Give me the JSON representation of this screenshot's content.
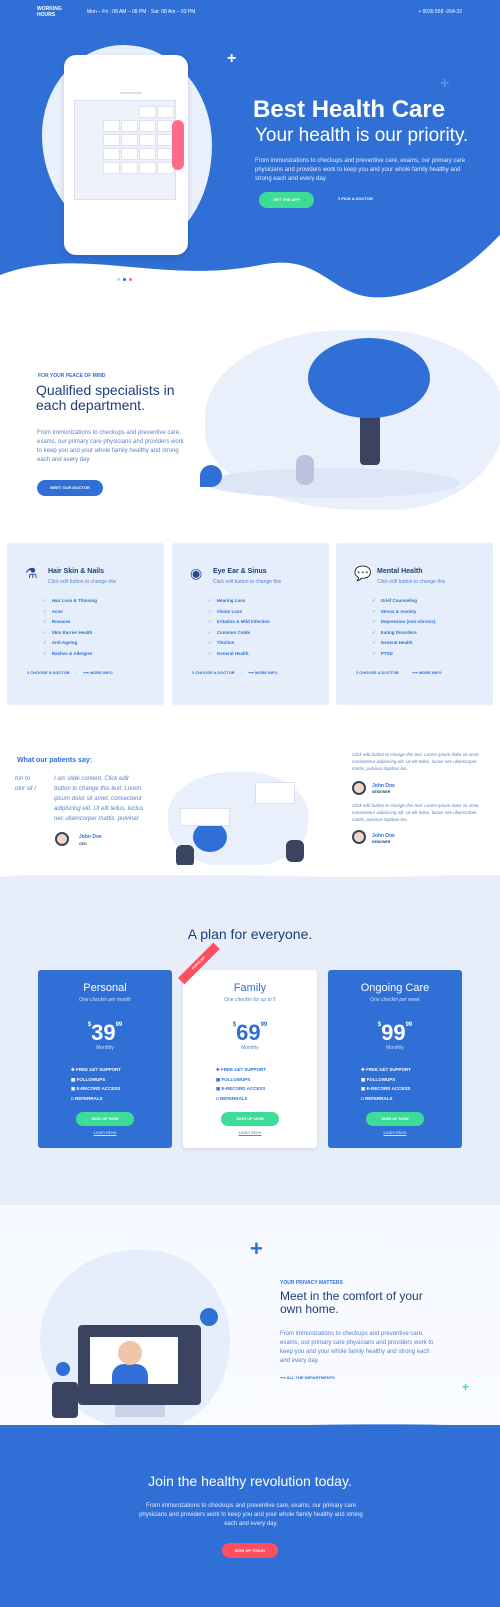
{
  "topbar": {
    "brand_line1": "WORKING",
    "brand_line2": "HOURS",
    "hours": "Mon – Fri : 08 AM – 08 PM · Sat: 08 Am – 03 PM",
    "phone": "+ 0035 558 -264-32"
  },
  "hero": {
    "title": "Best Health Care",
    "subtitle": "Your health is our priority.",
    "description": "From immunizations to checkups and preventive care, exams, our primary care physicians and providers work to keep you and your whole family healthy and strong each and every day.",
    "cta_label": "GET THE APP",
    "doctor_label": "PICK A DOCTOR"
  },
  "qualified": {
    "eyebrow": "FOR YOUR PEACE OF MIND",
    "title": "Qualified specialists in each department.",
    "description": "From immunizations to checkups and preventive care, exams, our primary care physicians and providers work to keep you and your whole family healthy and strong each and every day.",
    "button": "MEET OUR DOCTOR"
  },
  "departments": [
    {
      "icon": "flask-icon",
      "title": "Hair Skin & Nails",
      "subtitle": "Click edit button to change this",
      "items": [
        "Hair Loss & Thinning",
        "Acne",
        "Rosacea",
        "Skin Barrier Health",
        "Anti-Ageing",
        "Rashes & Allergies"
      ],
      "choose": "CHOOSE A DOCTOR",
      "more": "MORE INFO"
    },
    {
      "icon": "eye-icon",
      "title": "Eye Ear & Sinus",
      "subtitle": "Click edit button to change this",
      "items": [
        "Hearing Loss",
        "Vision Loss",
        "Irritation & Mild Infection",
        "Common Colds",
        "Tinnitus",
        "General Health"
      ],
      "choose": "CHOOSE A DOCTOR",
      "more": "MORE INFO"
    },
    {
      "icon": "chat-bubble-icon",
      "title": "Mental Health",
      "subtitle": "Click edit button to change this",
      "items": [
        "Grief Counseling",
        "Stress & Anxiety",
        "Depression (non-chronic)",
        "Eating Disorders",
        "General Health",
        "PTSD"
      ],
      "choose": "CHOOSE A DOCTOR",
      "more": "MORE INFO"
    }
  ],
  "testimonials": {
    "title": "What our patients say:",
    "left_fragment": "ton to olor sit r",
    "quote": "I am slide content. Click edit button to change this text. Lorem ipsum dolor sit amet, consectetur adipiscing elit. Ut elit tellus, luctus nec ullamcorper mattis, pulvinar dapibus leo.",
    "name": "John Doe",
    "role": "CEO",
    "right_quote": "Click edit button to change this text. Lorem ipsum dolor sit amet, consectetur adipiscing elit. Ut elit tellus, luctus nec ullamcorper mattis, pulvinar dapibus leo.",
    "right_name": "John Doe",
    "right_role": "DESIGNER"
  },
  "pricing": {
    "title": "A plan for everyone.",
    "ribbon": "POPULAR",
    "plans": [
      {
        "name": "Personal",
        "note": "One checkin per month",
        "currency": "$",
        "price": "39",
        "cents": "99",
        "period": "Monthly",
        "features": [
          "FREE 24/7 SUPPORT",
          "FOLLOWUPS",
          "E-RECORD ACCESS",
          "REFERRALS"
        ],
        "button": "SIGN UP NOW",
        "learn": "Learn More"
      },
      {
        "name": "Family",
        "note": "One checkin for up to 5",
        "currency": "$",
        "price": "69",
        "cents": "99",
        "period": "Monthly",
        "features": [
          "FREE 24/7 SUPPORT",
          "FOLLOWUPS",
          "E-RECORD ACCESS",
          "REFERRALS"
        ],
        "button": "SIGN UP NOW",
        "learn": "Learn More"
      },
      {
        "name": "Ongoing Care",
        "note": "One checkin per week",
        "currency": "$",
        "price": "99",
        "cents": "99",
        "period": "Monthly",
        "features": [
          "FREE 24/7 SUPPORT",
          "FOLLOWUPS",
          "E-RECORD ACCESS",
          "REFERRALS"
        ],
        "button": "SIGN UP NOW",
        "learn": "Learn More"
      }
    ]
  },
  "home": {
    "eyebrow": "YOUR PRIVACY MATTERS",
    "title": "Meet in the comfort of your own home.",
    "description": "From immunizations to checkups and preventive care, exams, our primary care physicians and providers work to keep you and your whole family healthy and strong each and every day.",
    "link": "ALL THE DEPARTMENTS"
  },
  "join": {
    "title": "Join the healthy revolution today.",
    "description": "From immunizations to checkups and preventive care, exams, our primary care physicians and providers work to keep you and your whole family healthy and strong each and every day.",
    "button": "SIGN UP TODAY"
  },
  "colors": {
    "primary": "#2f6fd6",
    "accent": "#3ddc97",
    "danger": "#ff4f5e",
    "light": "#e6eefb"
  }
}
